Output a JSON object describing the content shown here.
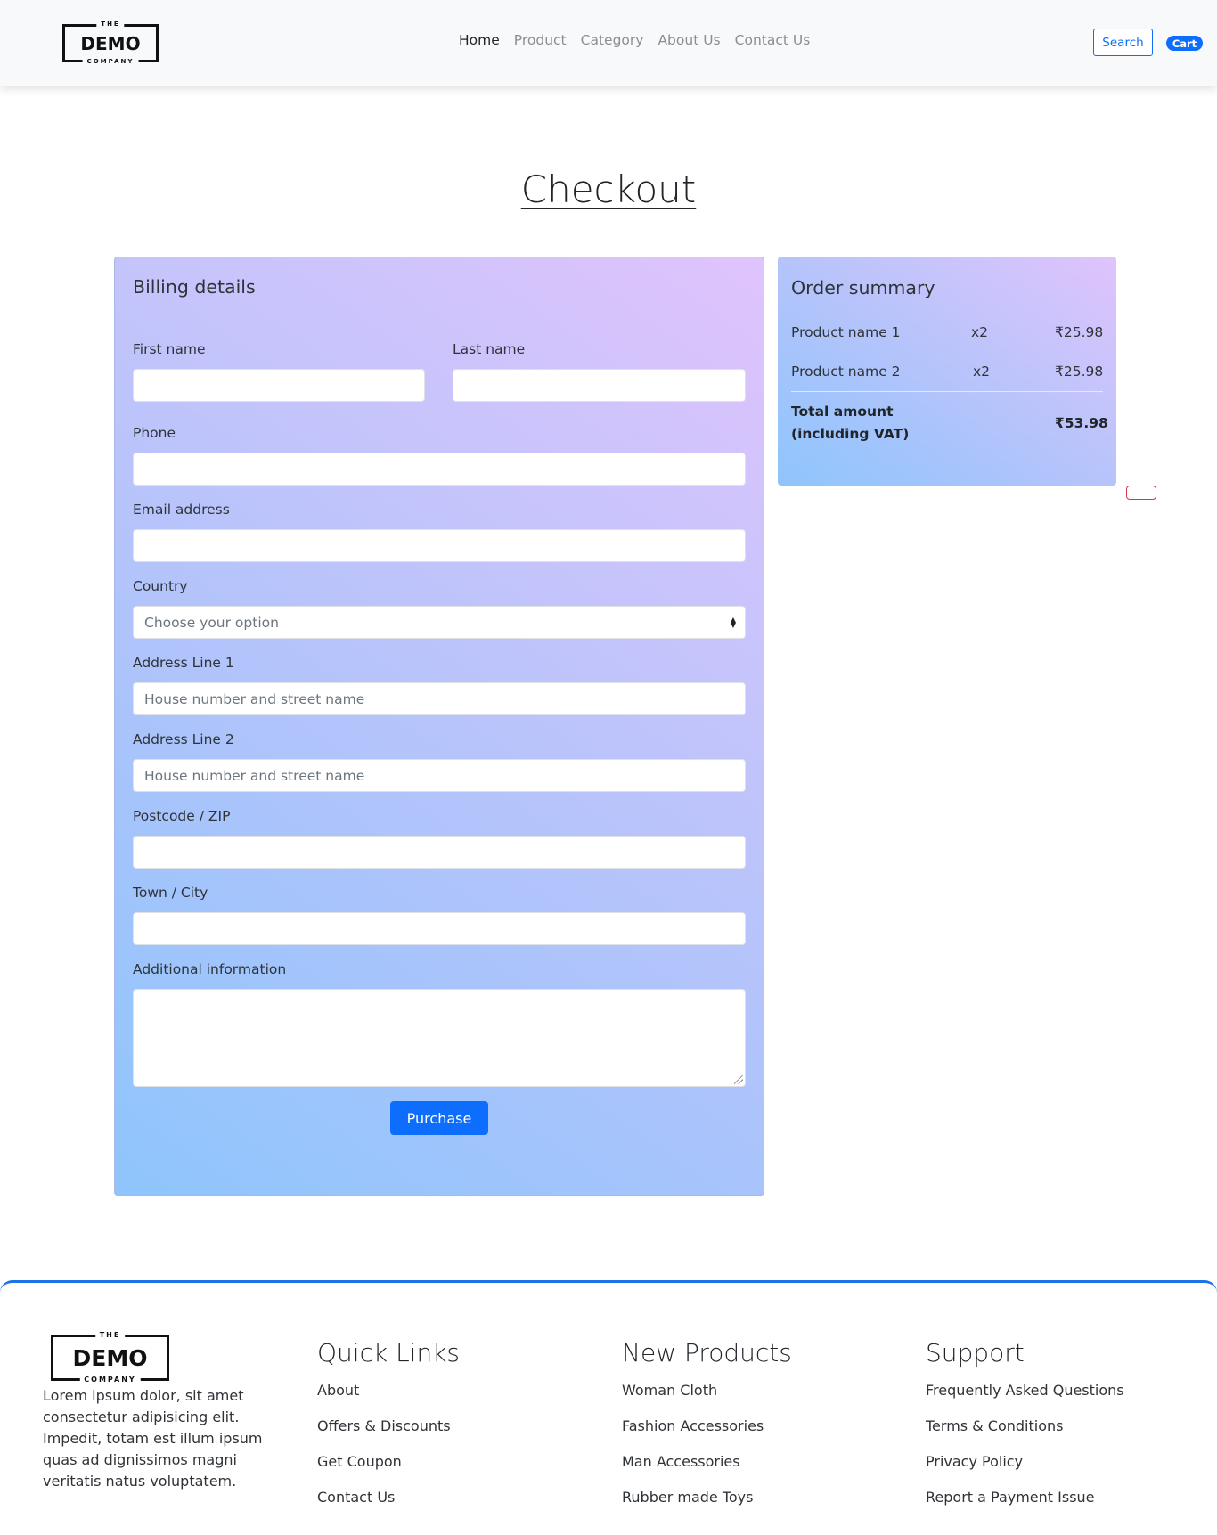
{
  "nav": {
    "logo": {
      "top": "THE",
      "main": "DEMO",
      "bottom": "COMPANY"
    },
    "links": [
      "Home",
      "Product",
      "Category",
      "About Us",
      "Contact Us"
    ],
    "search_label": "Search",
    "cart_label": "Cart"
  },
  "page_title": "Checkout",
  "billing": {
    "heading": "Billing details",
    "first_name_label": "First name",
    "last_name_label": "Last name",
    "phone_label": "Phone",
    "email_label": "Email address",
    "country_label": "Country",
    "country_selected": "Choose your option",
    "address1_label": "Address Line 1",
    "address1_placeholder": "House number and street name",
    "address2_label": "Address Line 2",
    "address2_placeholder": "House number and street name",
    "postcode_label": "Postcode / ZIP",
    "city_label": "Town / City",
    "additional_label": "Additional information",
    "purchase_label": "Purchase"
  },
  "summary": {
    "heading": "Order summary",
    "items": [
      {
        "name": "Product name 1",
        "qty": "x2",
        "price": "₹25.98"
      },
      {
        "name": "Product name 2",
        "qty": "x2",
        "price": "₹25.98"
      }
    ],
    "total_label_line1": "Total amount",
    "total_label_line2": "(including VAT)",
    "total_value": "₹53.98"
  },
  "footer": {
    "logo": {
      "top": "THE",
      "main": "DEMO",
      "bottom": "COMPANY"
    },
    "description": "Lorem ipsum dolor, sit amet consectetur adipisicing elit. Impedit, totam est illum ipsum quas ad dignissimos magni veritatis natus voluptatem.",
    "quick_links": {
      "title": "Quick Links",
      "items": [
        "About",
        "Offers & Discounts",
        "Get Coupon",
        "Contact Us"
      ]
    },
    "new_products": {
      "title": "New Products",
      "items": [
        "Woman Cloth",
        "Fashion Accessories",
        "Man Accessories",
        "Rubber made Toys"
      ]
    },
    "support": {
      "title": "Support",
      "items": [
        "Frequently Asked Questions",
        "Terms & Conditions",
        "Privacy Policy",
        "Report a Payment Issue"
      ]
    }
  },
  "colors": {
    "primary": "#0d6efd",
    "gradient_start": "#8ec5fc",
    "gradient_end": "#e0c3fc",
    "footer_accent": "#1a73e8",
    "alert_outline": "#dc3545"
  }
}
